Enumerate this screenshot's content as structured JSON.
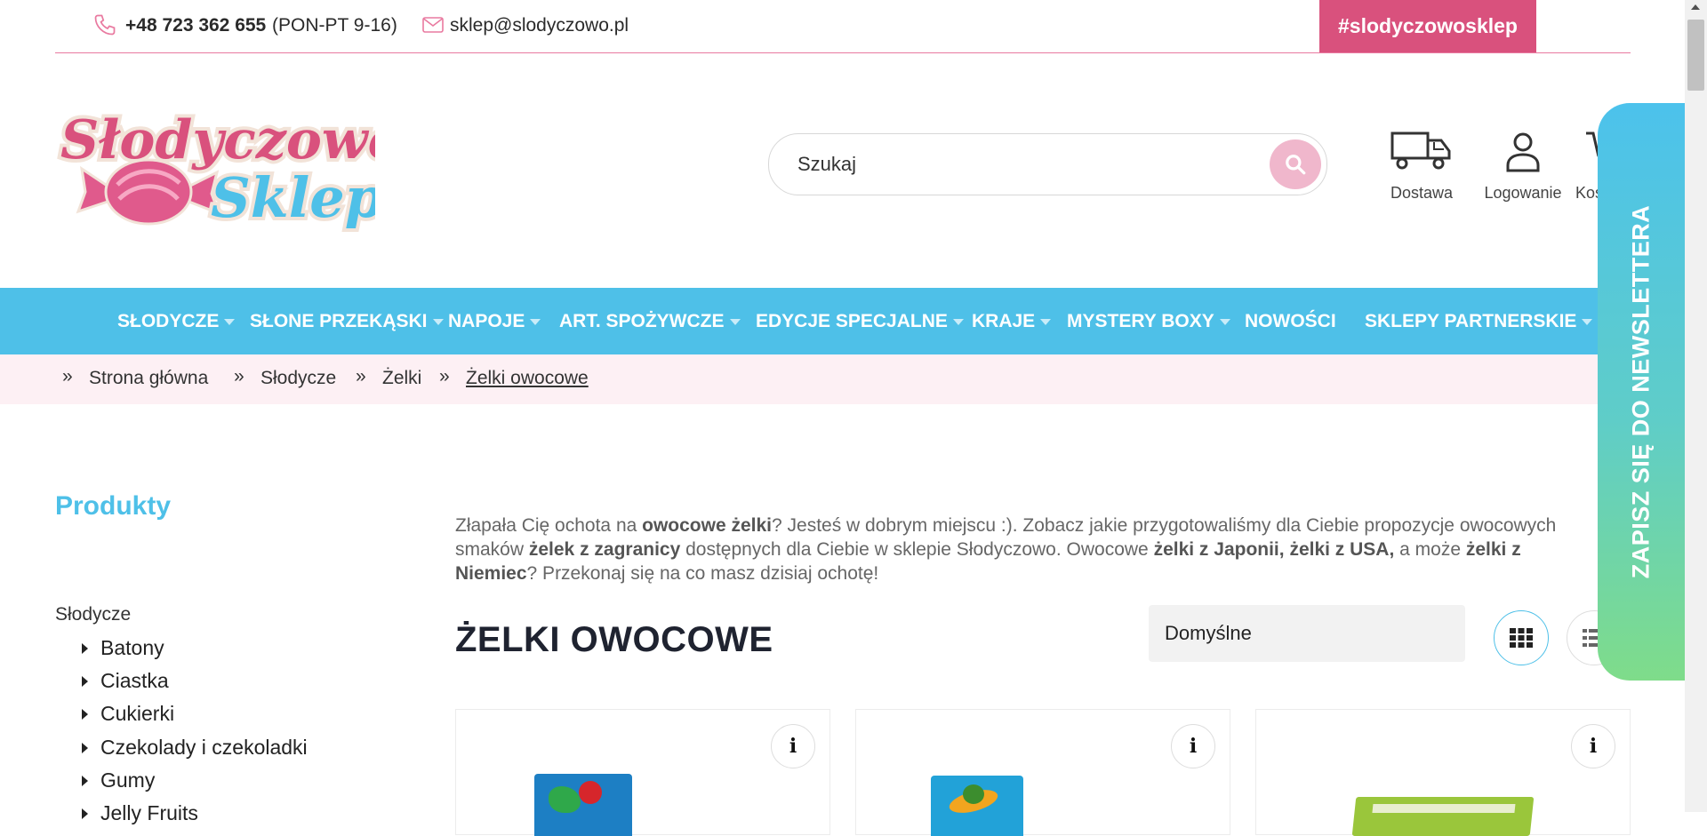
{
  "topbar": {
    "phone": "+48 723 362 655",
    "hours": "(PON-PT 9-16)",
    "email": "sklep@slodyczowo.pl",
    "hashtag": "#slodyczowosklep"
  },
  "logo": {
    "line1": "Słodyczowo",
    "line2": "Sklep"
  },
  "search": {
    "placeholder": "Szukaj"
  },
  "header_actions": {
    "delivery": "Dostawa",
    "login": "Logowanie",
    "cart": "Koszyk"
  },
  "nav": {
    "items": [
      {
        "label": "SŁODYCZE"
      },
      {
        "label": "SŁONE PRZEKĄSKI"
      },
      {
        "label": "NAPOJE"
      },
      {
        "label": "ART. SPOŻYWCZE"
      },
      {
        "label": "EDYCJE SPECJALNE"
      },
      {
        "label": "KRAJE"
      },
      {
        "label": "MYSTERY BOXY"
      },
      {
        "label": "NOWOŚCI"
      },
      {
        "label": "SKLEPY PARTNERSKIE"
      }
    ]
  },
  "breadcrumb": {
    "separator": "»",
    "items": [
      "Strona główna",
      "Słodycze",
      "Żelki",
      "Żelki owocowe"
    ]
  },
  "sidebar": {
    "title": "Produkty",
    "root": "Słodycze",
    "items": [
      "Batony",
      "Ciastka",
      "Cukierki",
      "Czekolady i czekoladki",
      "Gumy",
      "Jelly Fruits"
    ]
  },
  "description": {
    "p1": "Złapała Cię ochota na ",
    "b1": "owocowe żelki",
    "p2": "? Jesteś w dobrym miejscu :). Zobacz jakie przygotowaliśmy dla Ciebie propozycje owocowych smaków ",
    "b2": "żelek z zagranicy",
    "p3": " dostępnych dla Ciebie w sklepie Słodyczowo. Owocowe ",
    "b3": "żelki z Japonii, żelki z USA,",
    "p4": " a może ",
    "b4": "żelki z Niemiec",
    "p5": "? Przekonaj się na co masz dzisiaj ochotę!"
  },
  "listing": {
    "title": "ŻELKI OWOCOWE",
    "sort_value": "Domyślne",
    "info_label": "i"
  },
  "newsletter": {
    "label": "ZAPISZ SIĘ DO NEWSLETTERA"
  },
  "colors": {
    "pink": "#d9517d",
    "blue": "#4ec0e8",
    "light_pink": "#fdf0f4"
  }
}
